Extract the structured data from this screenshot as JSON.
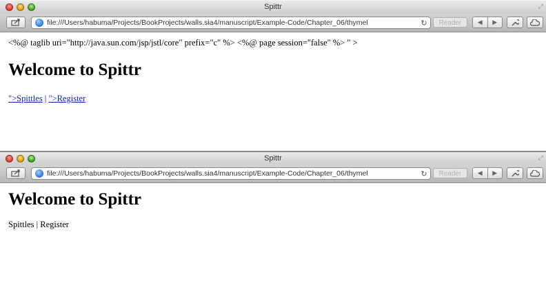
{
  "windows": [
    {
      "title": "Spittr",
      "url": "file:///Users/habuma/Projects/BookProjects/walls.sia4/manuscript/Example-Code/Chapter_06/thymel",
      "reader_label": "Reader",
      "content": {
        "raw_directive": "<%@ taglib uri=\"http://java.sun.com/jsp/jstl/core\" prefix=\"c\" %> <%@ page session=\"false\" %> \" >",
        "heading": "Welcome to Spittr",
        "link_spittles": "\">Spittles",
        "separator": " | ",
        "link_register": "\">Register"
      }
    },
    {
      "title": "Spittr",
      "url": "file:///Users/habuma/Projects/BookProjects/walls.sia4/manuscript/Example-Code/Chapter_06/thymel",
      "reader_label": "Reader",
      "content": {
        "heading": "Welcome to Spittr",
        "spittles_text": "Spittles",
        "separator": " | ",
        "register_text": "Register"
      }
    }
  ]
}
